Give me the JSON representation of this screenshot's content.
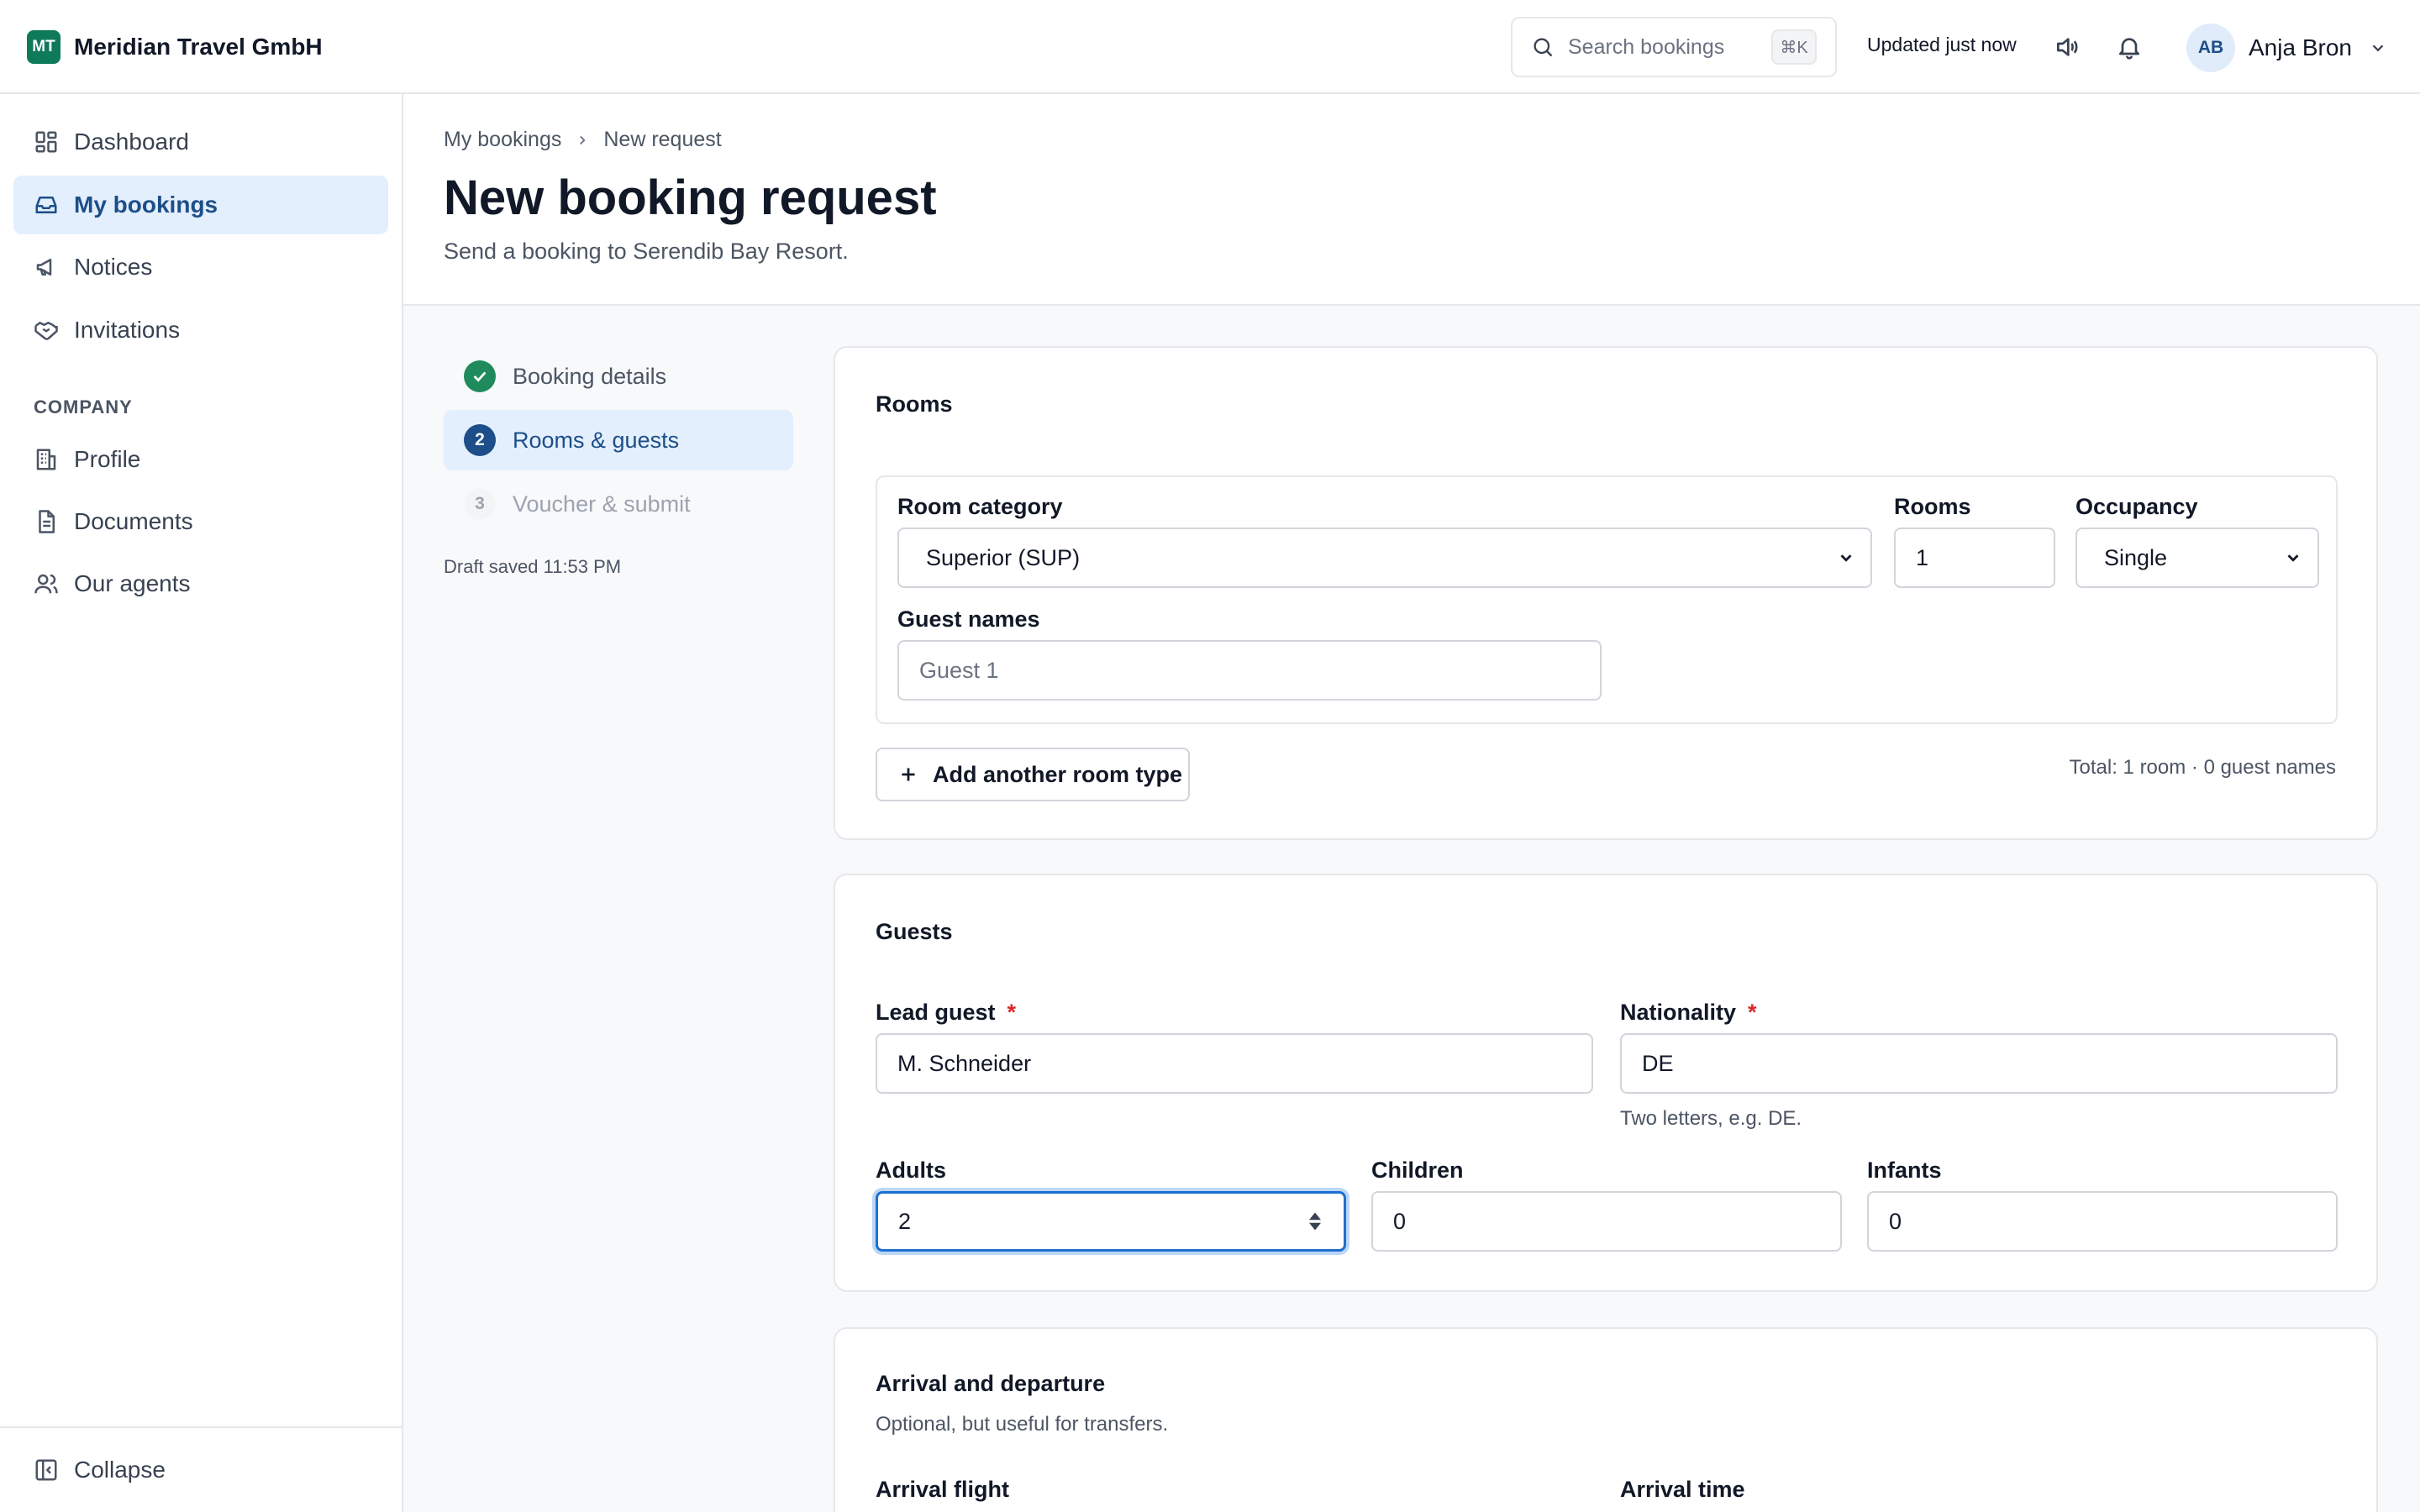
{
  "header": {
    "brand_initials": "MT",
    "brand_name": "Meridian Travel GmbH",
    "search_placeholder": "Search bookings",
    "search_shortcut": "⌘K",
    "status": "Updated just now",
    "user_initials": "AB",
    "user_name": "Anja Bron"
  },
  "sidebar": {
    "items": [
      {
        "label": "Dashboard",
        "icon": "dashboard-icon"
      },
      {
        "label": "My bookings",
        "icon": "inbox-icon",
        "active": true
      },
      {
        "label": "Notices",
        "icon": "megaphone-icon"
      },
      {
        "label": "Invitations",
        "icon": "handshake-icon"
      }
    ],
    "section_label": "COMPANY",
    "company_items": [
      {
        "label": "Profile",
        "icon": "building-icon"
      },
      {
        "label": "Documents",
        "icon": "document-icon"
      },
      {
        "label": "Our agents",
        "icon": "users-icon"
      }
    ],
    "collapse_label": "Collapse"
  },
  "breadcrumb": {
    "parent": "My bookings",
    "current": "New request"
  },
  "page": {
    "title": "New booking request",
    "subtitle": "Send a booking to Serendib Bay Resort."
  },
  "steps": [
    {
      "number": "1",
      "label": "Booking details",
      "state": "done"
    },
    {
      "number": "2",
      "label": "Rooms & guests",
      "state": "current"
    },
    {
      "number": "3",
      "label": "Voucher & submit",
      "state": "future"
    }
  ],
  "draft_status": "Draft saved 11:53 PM",
  "rooms_card": {
    "title": "Rooms",
    "room_category_label": "Room category",
    "room_category_value": "Superior (SUP)",
    "rooms_label": "Rooms",
    "rooms_value": "1",
    "occupancy_label": "Occupancy",
    "occupancy_value": "Single",
    "guest_names_label": "Guest names",
    "guest_names_placeholder": "Guest 1",
    "add_button": "Add another room type",
    "total": "Total: 1 room · 0 guest names"
  },
  "guests_card": {
    "title": "Guests",
    "lead_guest_label": "Lead guest",
    "lead_guest_value": "M. Schneider",
    "nationality_label": "Nationality",
    "nationality_value": "DE",
    "nationality_hint": "Two letters, e.g. DE.",
    "required_mark": "*",
    "adults_label": "Adults",
    "adults_value": "2",
    "children_label": "Children",
    "children_value": "0",
    "infants_label": "Infants",
    "infants_value": "0"
  },
  "arrival_card": {
    "title": "Arrival and departure",
    "subtitle": "Optional, but useful for transfers.",
    "arrival_flight_label": "Arrival flight",
    "arrival_time_label": "Arrival time"
  },
  "colors": {
    "accent": "#1d4e89",
    "brand": "#0f7a5a",
    "success": "#1f8a5b",
    "required": "#dc2626"
  }
}
